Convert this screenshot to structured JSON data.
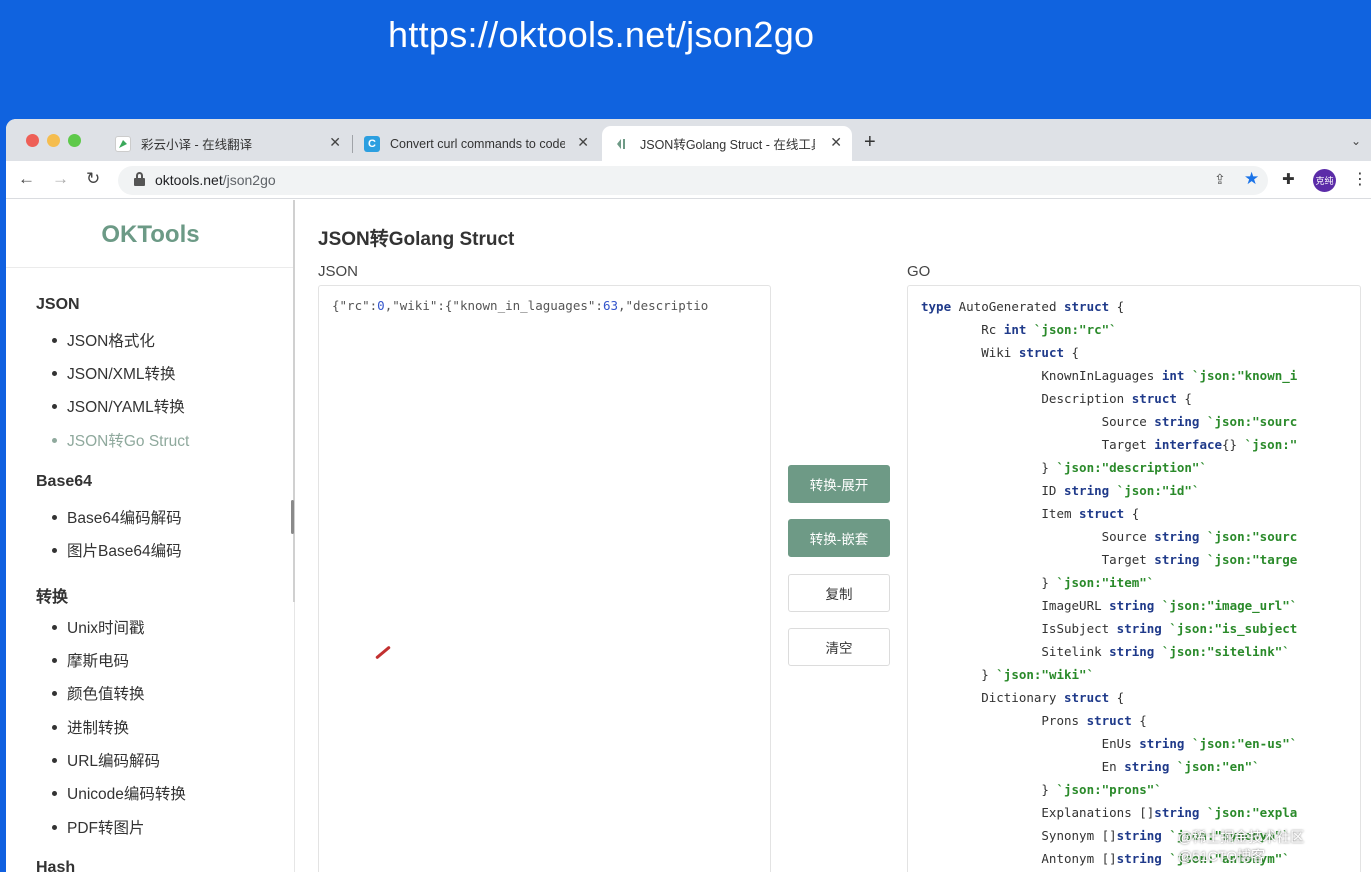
{
  "banner": {
    "url": "https://oktools.net/json2go"
  },
  "browser": {
    "tabs": [
      {
        "title": "彩云小译 - 在线翻译",
        "icon": "caiyun-favicon-icon"
      },
      {
        "title": "Convert curl commands to code",
        "icon": "curlconverter-favicon-icon"
      },
      {
        "title": "JSON转Golang Struct - 在线工具",
        "icon": "oktools-favicon-icon",
        "active": true
      }
    ],
    "address": {
      "host": "oktools.net",
      "path": "/json2go"
    },
    "avatar_label": "克纯"
  },
  "sidebar": {
    "brand": "OKTools",
    "sections": [
      {
        "title": "JSON",
        "items": [
          "JSON格式化",
          "JSON/XML转换",
          "JSON/YAML转换",
          "JSON转Go Struct"
        ]
      },
      {
        "title": "Base64",
        "items": [
          "Base64编码解码",
          "图片Base64编码"
        ]
      },
      {
        "title": "转换",
        "items": [
          "Unix时间戳",
          "摩斯电码",
          "颜色值转换",
          "进制转换",
          "URL编码解码",
          "Unicode编码转换",
          "PDF转图片"
        ]
      },
      {
        "title": "Hash",
        "items": []
      }
    ],
    "active_item": "JSON转Go Struct"
  },
  "main": {
    "title": "JSON转Golang Struct",
    "json_label": "JSON",
    "go_label": "GO",
    "json_input": "{\"rc\":0,\"wiki\":{\"known_in_laguages\":63,\"descriptio",
    "buttons": {
      "convert_expand": "转换-展开",
      "convert_nested": "转换-嵌套",
      "copy": "复制",
      "clear": "清空"
    },
    "go_output_lines": [
      "type AutoGenerated struct {",
      "        Rc int `json:\"rc\"`",
      "        Wiki struct {",
      "                KnownInLaguages int `json:\"known_i",
      "                Description struct {",
      "                        Source string `json:\"sourc",
      "                        Target interface{} `json:\"",
      "                } `json:\"description\"`",
      "                ID string `json:\"id\"`",
      "                Item struct {",
      "                        Source string `json:\"sourc",
      "                        Target string `json:\"targe",
      "                } `json:\"item\"`",
      "                ImageURL string `json:\"image_url\"`",
      "                IsSubject string `json:\"is_subject",
      "                Sitelink string `json:\"sitelink\"`",
      "        } `json:\"wiki\"`",
      "        Dictionary struct {",
      "                Prons struct {",
      "                        EnUs string `json:\"en-us\"`",
      "                        En string `json:\"en\"`",
      "                } `json:\"prons\"`",
      "                Explanations []string `json:\"expla",
      "                Synonym []string `json:\"synonym\"`",
      "                Antonym []string `json:\"antonym\"`"
    ]
  },
  "watermark": [
    "@稀土掘金技术社区",
    "@51CTO博客"
  ],
  "colors": {
    "banner": "#1063df",
    "accent": "#6e9a86",
    "keyword": "#1f3a8a",
    "tag": "#2a8a2a"
  }
}
